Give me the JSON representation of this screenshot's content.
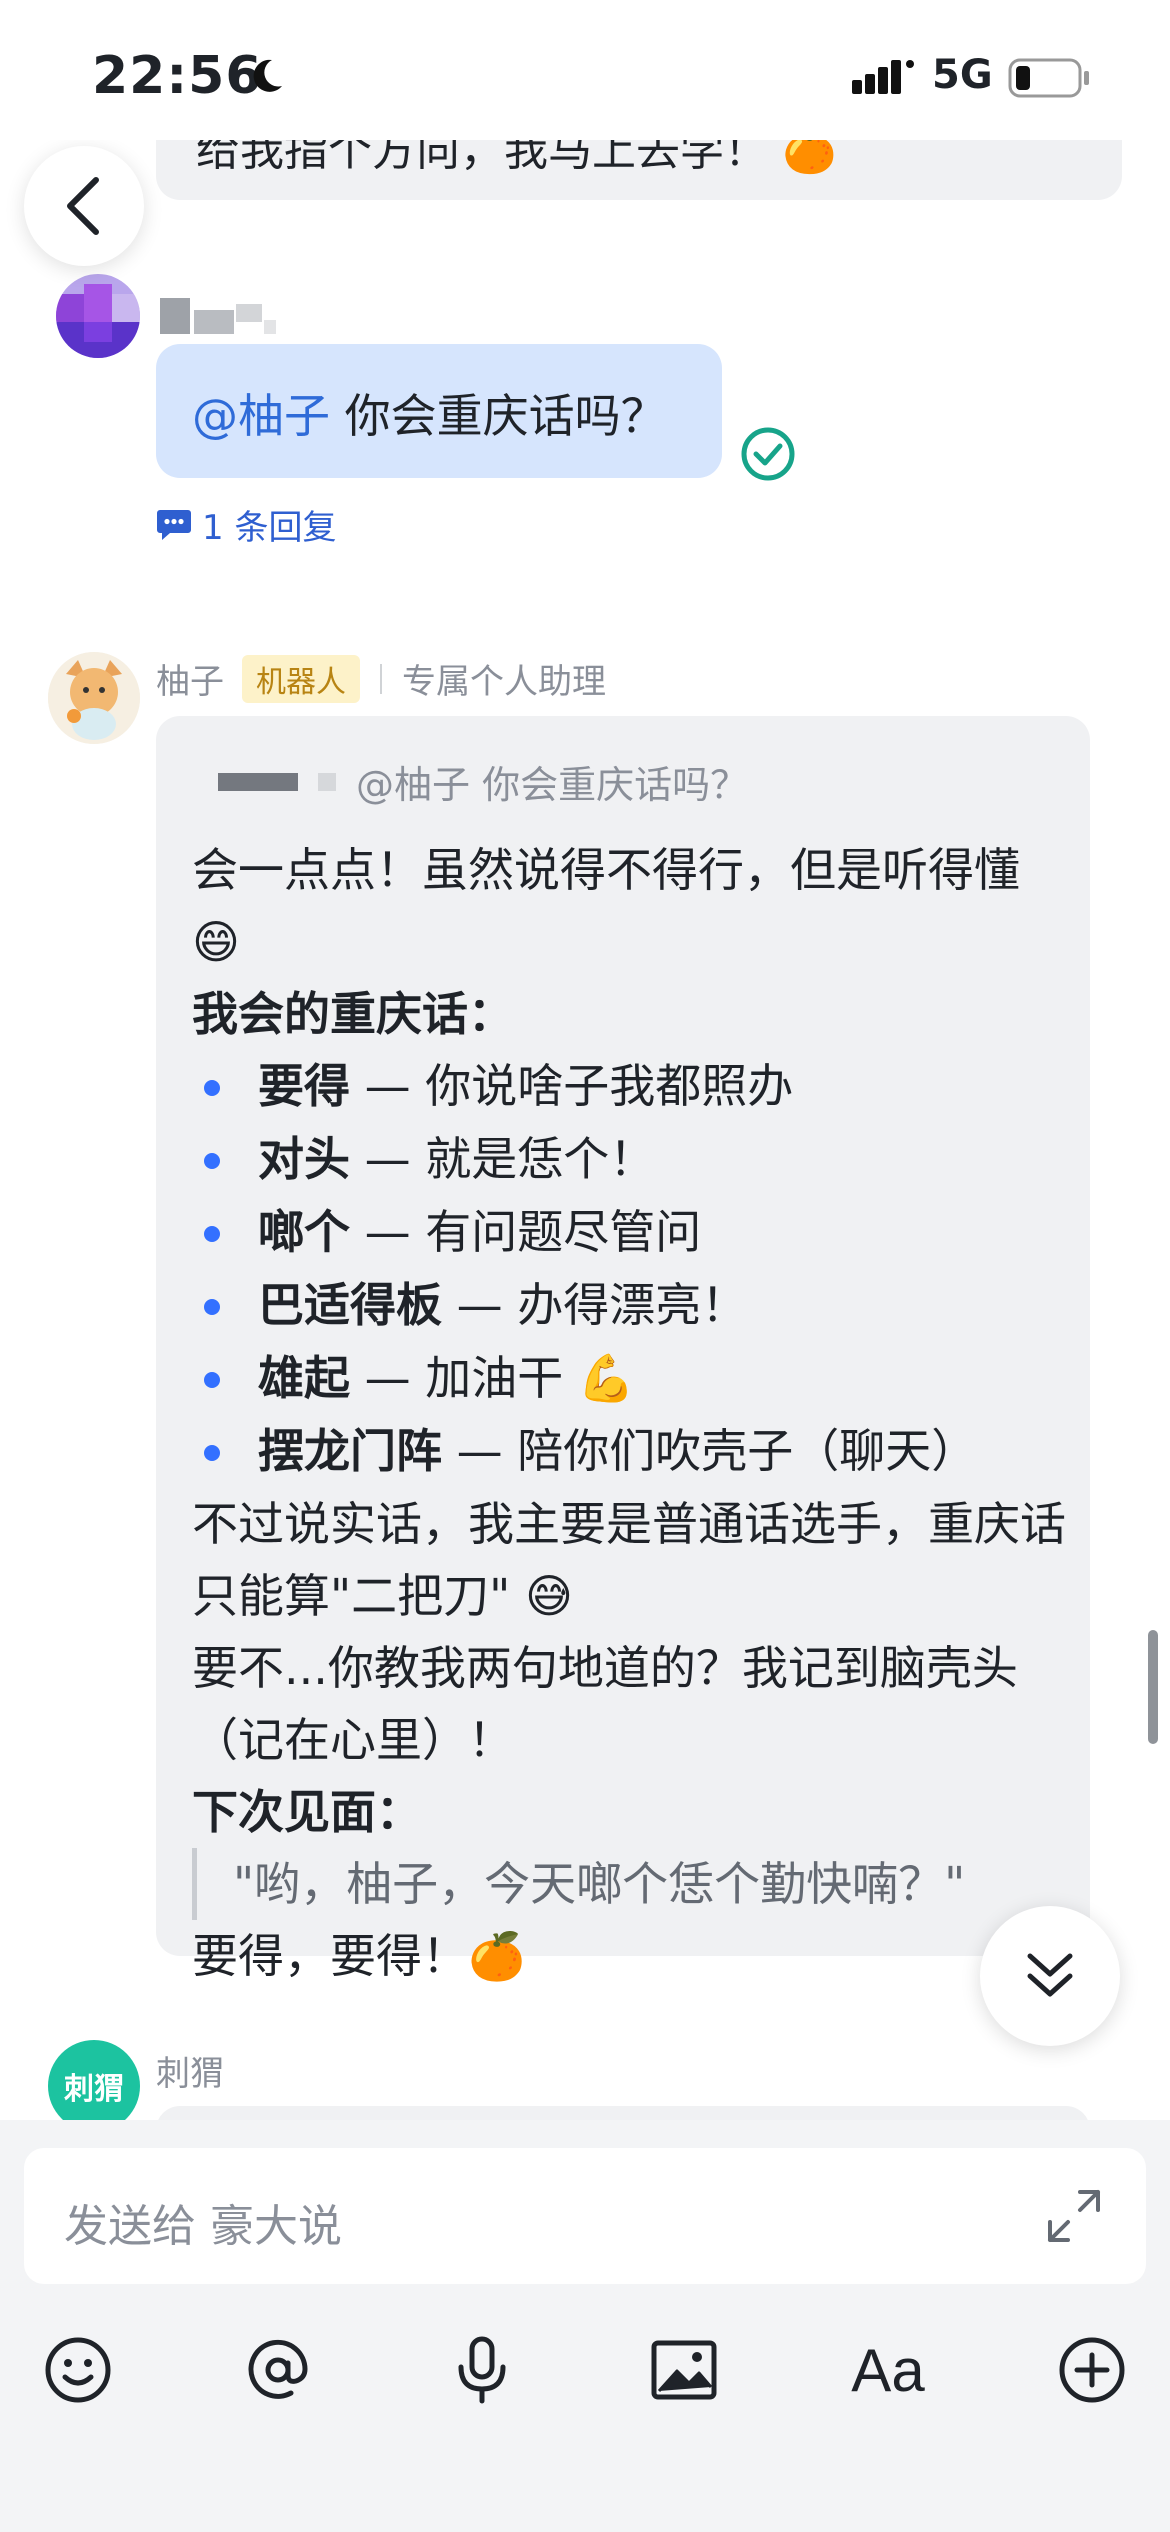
{
  "status_bar": {
    "time": "22:56",
    "network": "5G"
  },
  "chat": {
    "previous_message_fragment": "给我指个方向，我马上去学！ 🍊",
    "user_message": {
      "mention": "@柚子",
      "text": " 你会重庆话吗？",
      "reply_count": "1 条回复"
    },
    "bot": {
      "name": "柚子",
      "badge": "机器人",
      "description": "专属个人助理",
      "quote": "@柚子 你会重庆话吗？",
      "intro": "会一点点！虽然说得不得行，但是听得懂 😄",
      "list_title": "我会的重庆话：",
      "items": [
        {
          "term": "要得",
          "meaning": " — 你说啥子我都照办"
        },
        {
          "term": "对头",
          "meaning": " — 就是恁个！"
        },
        {
          "term": "啷个",
          "meaning": " — 有问题尽管问"
        },
        {
          "term": "巴适得板",
          "meaning": " — 办得漂亮！"
        },
        {
          "term": "雄起",
          "meaning": " — 加油干 💪"
        },
        {
          "term": "摆龙门阵",
          "meaning": " — 陪你们吹壳子（聊天）"
        }
      ],
      "para1": "不过说实话，我主要是普通话选手，重庆话只能算\"二把刀\" 😅",
      "para2": "要不...你教我两句地道的？我记到脑壳头（记在心里）！",
      "next_title": "下次见面：",
      "blockquote": "\"哟，柚子，今天啷个恁个勤快喃？\"",
      "closing": "要得，要得！🍊"
    },
    "next_sender": {
      "avatar_text": "刺猬",
      "name": "刺猬"
    }
  },
  "composer": {
    "placeholder": "发送给 豪大说",
    "toolbar_icons": [
      "emoji-icon",
      "mention-icon",
      "microphone-icon",
      "image-icon",
      "font-format-icon",
      "add-icon"
    ],
    "font_glyph": "Aa"
  },
  "colors": {
    "accent": "#3370ff",
    "user_bubble": "#d6e5fd",
    "bot_bubble": "#f0f1f3",
    "badge_bg": "#fdf2c9",
    "check_green": "#17a48a"
  }
}
